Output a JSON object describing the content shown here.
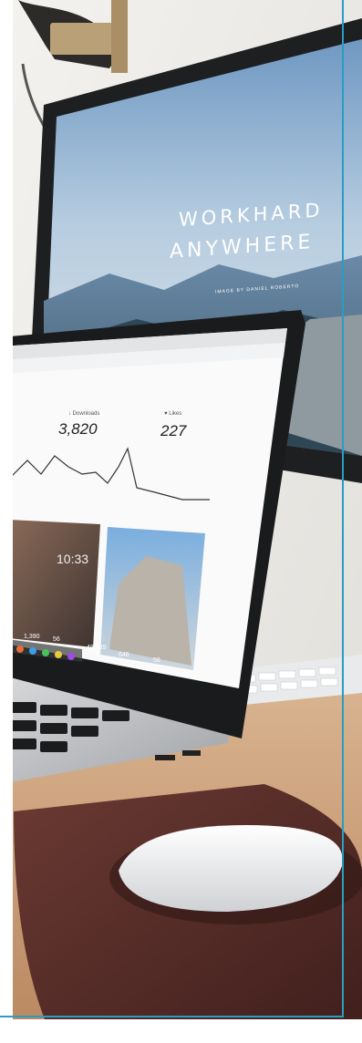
{
  "monitor": {
    "headline_line1": "WORKHARD",
    "headline_line2": "ANYWHERE",
    "credit": "IMAGE BY DANIEL ROBERTO"
  },
  "laptop_screen": {
    "downloads_label": "↓ Downloads",
    "downloads_value": "3,820",
    "likes_label": "♥ Likes",
    "likes_value": "227",
    "time_tile": "10:33",
    "stat_1": "1,390",
    "stat_2": "56",
    "stat_3": "48,535",
    "stat_4": "646",
    "stat_5": "58"
  },
  "colors": {
    "accent_frame": "#2a9dc4",
    "wall": "#ecebe8",
    "desk": "#c79a72",
    "mousepad": "#5a2e2a",
    "sky": "#8fb2cf"
  }
}
